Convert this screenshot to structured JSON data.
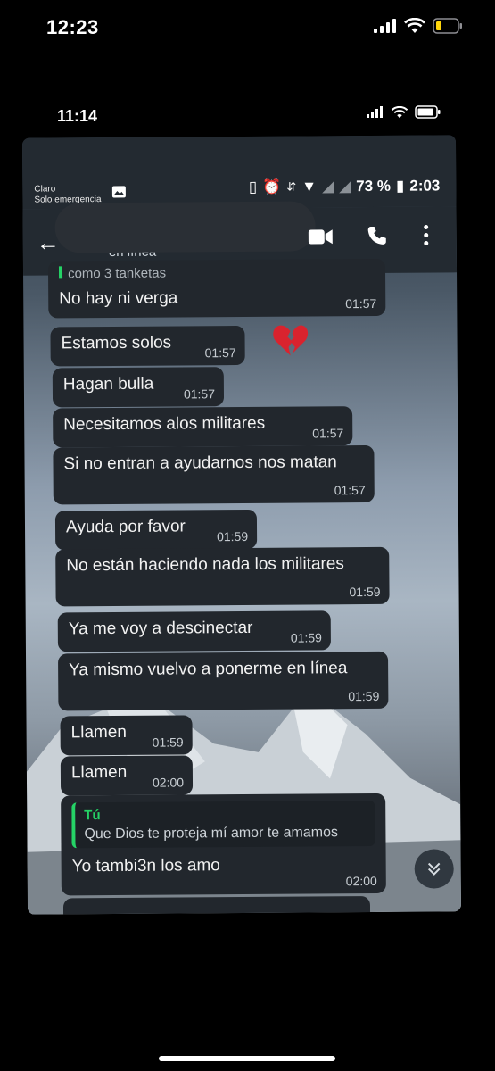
{
  "outer_status": {
    "time": "12:23"
  },
  "inner_status": {
    "time": "11:14"
  },
  "android_status": {
    "carrier_line1": "Claro",
    "carrier_line2": "Solo emergencia",
    "battery": "73 %",
    "time": "2:03"
  },
  "chat_header": {
    "subtitle": "en línea",
    "partial_quote": "como 3 tanketas"
  },
  "messages": [
    {
      "text": "No hay ni verga",
      "time": "01:57"
    },
    {
      "text": "Estamos solos",
      "time": "01:57"
    },
    {
      "text": "Hagan bulla",
      "time": "01:57"
    },
    {
      "text": "Necesitamos alos militares",
      "time": "01:57"
    },
    {
      "text": "Si no entran a ayudarnos nos matan",
      "time": "01:57"
    },
    {
      "text": "Ayuda por favor",
      "time": "01:59"
    },
    {
      "text": "No están haciendo nada los militares",
      "time": "01:59"
    },
    {
      "text": "Ya me voy a descinectar",
      "time": "01:59"
    },
    {
      "text": "Ya mismo vuelvo a ponerme en línea",
      "time": "01:59"
    },
    {
      "text": "Llamen",
      "time": "01:59"
    },
    {
      "text": "Llamen",
      "time": "02:00"
    },
    {
      "text": "Yo tambi3n los amo",
      "time": "02:00",
      "quote_author": "Tú",
      "quote_text": "Que Dios te proteja mí amor te amamos"
    }
  ],
  "icons": {
    "outer": [
      "signal-icon",
      "wifi-icon",
      "battery-low-icon"
    ],
    "header": [
      "back-arrow-icon",
      "video-call-icon",
      "phone-icon",
      "more-vert-icon"
    ],
    "scroll": "double-chevron-down-icon",
    "reaction": "broken-heart-icon"
  },
  "colors": {
    "bubble": "#22272d",
    "quote_accent": "#25d366",
    "battery_low": "#ffd60a"
  }
}
